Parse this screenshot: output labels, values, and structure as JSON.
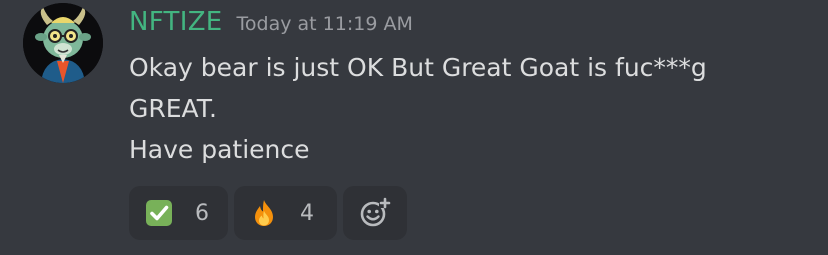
{
  "message": {
    "username": "NFTIZE",
    "timestamp": "Today at 11:19 AM",
    "lines": [
      "Okay bear is just OK But Great Goat is fuc***g",
      "GREAT.",
      "Have patience"
    ]
  },
  "reactions": [
    {
      "emoji": "check-mark-emoji",
      "count": "6"
    },
    {
      "emoji": "fire-emoji",
      "count": "4"
    }
  ],
  "colors": {
    "background": "#36393f",
    "username": "#43b581",
    "timestamp": "#9a9ca1",
    "text": "#dcddde",
    "reaction_bg": "#2f3136",
    "reaction_count": "#b9bbbe"
  }
}
